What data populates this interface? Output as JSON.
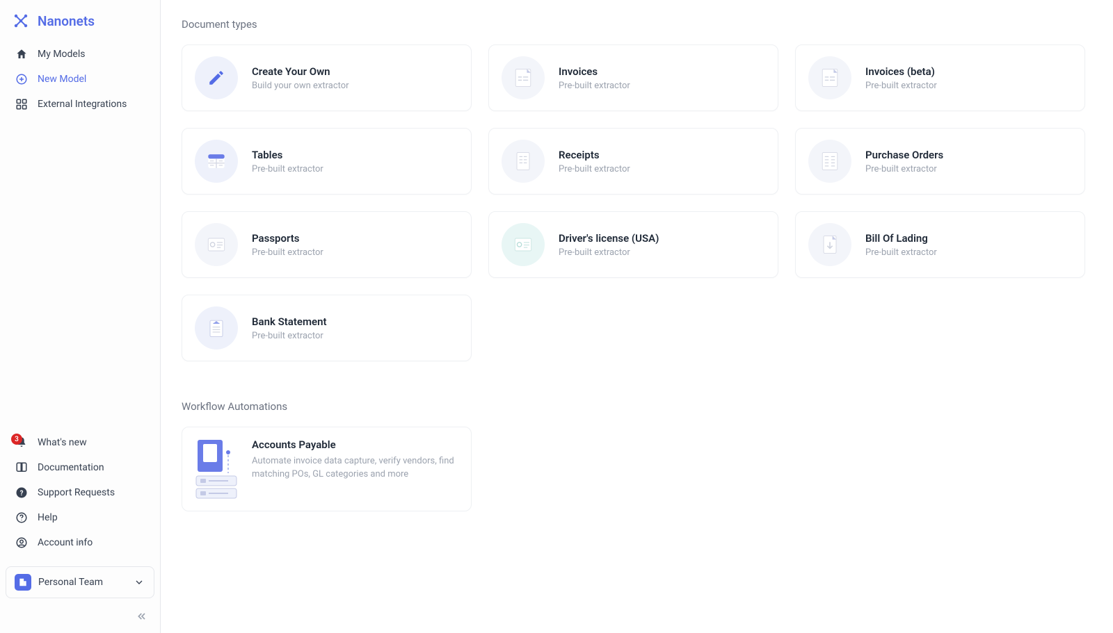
{
  "brand": {
    "name": "Nanonets"
  },
  "sidebar": {
    "top": [
      {
        "label": "My Models"
      },
      {
        "label": "New Model"
      },
      {
        "label": "External Integrations"
      }
    ],
    "bottom": [
      {
        "label": "What's new",
        "badge": "3"
      },
      {
        "label": "Documentation"
      },
      {
        "label": "Support Requests"
      },
      {
        "label": "Help"
      },
      {
        "label": "Account info"
      }
    ],
    "team": {
      "label": "Personal Team"
    }
  },
  "sections": {
    "doc_types_title": "Document types",
    "workflow_title": "Workflow Automations"
  },
  "cards": [
    {
      "title": "Create Your Own",
      "sub": "Build your own extractor"
    },
    {
      "title": "Invoices",
      "sub": "Pre-built extractor"
    },
    {
      "title": "Invoices (beta)",
      "sub": "Pre-built extractor"
    },
    {
      "title": "Tables",
      "sub": "Pre-built extractor"
    },
    {
      "title": "Receipts",
      "sub": "Pre-built extractor"
    },
    {
      "title": "Purchase Orders",
      "sub": "Pre-built extractor"
    },
    {
      "title": "Passports",
      "sub": "Pre-built extractor"
    },
    {
      "title": "Driver's license (USA)",
      "sub": "Pre-built extractor"
    },
    {
      "title": "Bill Of Lading",
      "sub": "Pre-built extractor"
    },
    {
      "title": "Bank Statement",
      "sub": "Pre-built extractor"
    }
  ],
  "workflows": [
    {
      "title": "Accounts Payable",
      "sub": "Automate invoice data capture, verify vendors, find matching POs, GL categories and more"
    }
  ]
}
